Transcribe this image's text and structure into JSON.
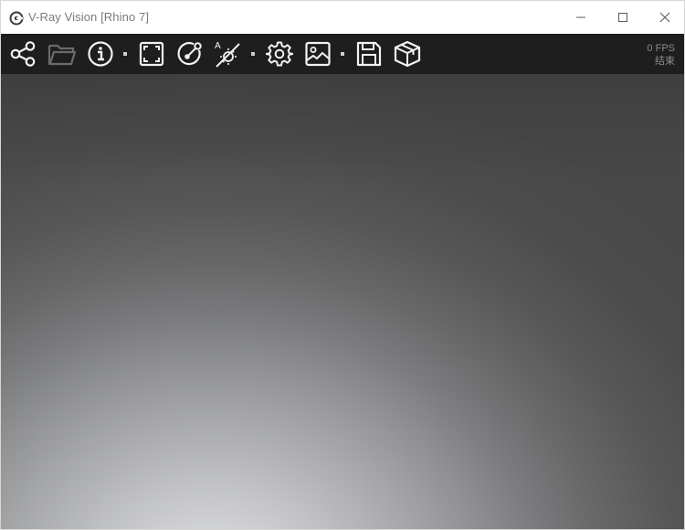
{
  "window": {
    "title": "V-Ray Vision [Rhino 7]"
  },
  "toolbar": {
    "items": [
      {
        "icon": "share-icon"
      },
      {
        "icon": "folder-open-icon"
      },
      {
        "icon": "info-icon"
      },
      {
        "icon": "fullscreen-icon"
      },
      {
        "icon": "camera-track-icon"
      },
      {
        "icon": "lighting-toggle-icon"
      },
      {
        "icon": "settings-gear-icon"
      },
      {
        "icon": "image-icon"
      },
      {
        "icon": "save-icon"
      },
      {
        "icon": "package-box-icon"
      }
    ],
    "fps_label": "0 FPS",
    "status_label": "结束"
  },
  "colors": {
    "toolbar_bg": "#1e1e1e",
    "icon": "#f2f2f2",
    "icon_disabled": "#6a6a6a",
    "viewport_dark": "#484848",
    "viewport_light": "#e6e7e9"
  }
}
